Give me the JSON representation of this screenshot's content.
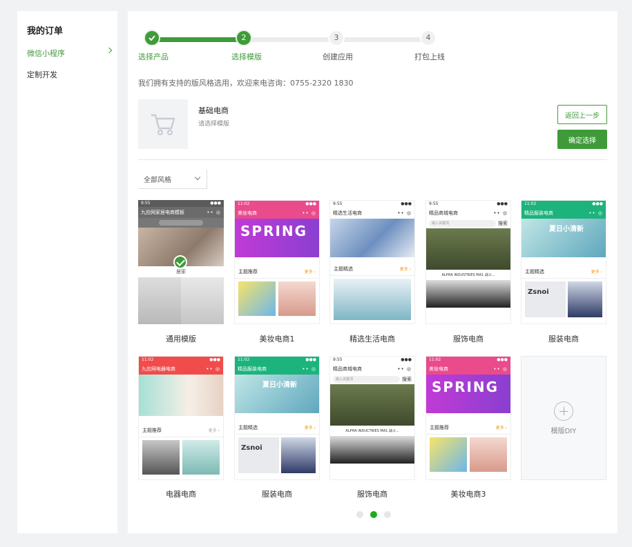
{
  "sidebar": {
    "title": "我的订单",
    "items": [
      {
        "label": "微信小程序",
        "active": true
      },
      {
        "label": "定制开发",
        "active": false
      }
    ]
  },
  "stepper": {
    "steps": [
      {
        "num": "",
        "label": "选择产品",
        "state": "done"
      },
      {
        "num": "2",
        "label": "选择模版",
        "state": "current"
      },
      {
        "num": "3",
        "label": "创建应用",
        "state": "todo"
      },
      {
        "num": "4",
        "label": "打包上线",
        "state": "todo"
      }
    ]
  },
  "notice": "我们拥有支持的版风格选用，欢迎来电咨询：0755-2320 1830",
  "product": {
    "name": "基础电商",
    "subtitle": "请选择模版",
    "back_label": "返回上一步",
    "confirm_label": "确定选择"
  },
  "filter": {
    "selected": "全部风格"
  },
  "templates": [
    {
      "label": "通用模版",
      "selected": true,
      "head": "九应网家居电商模板",
      "tab": "居家",
      "color": "#6b6b6b"
    },
    {
      "label": "美妆电商1",
      "selected": false,
      "head": "美妆电商",
      "banner": "SPRING",
      "section": "主题推荐",
      "color": "#e94b8b"
    },
    {
      "label": "精选生活电商",
      "selected": false,
      "head": "精选生活电商",
      "section": "主题精选",
      "color": "#ffffff"
    },
    {
      "label": "服饰电商",
      "selected": false,
      "head": "精品商城电商",
      "search_placeholder": "输入关键词",
      "search": "搜索",
      "product": "ALPHA INDUSTRIES MA1 战斗...",
      "color": "#ffffff"
    },
    {
      "label": "服装电商",
      "selected": false,
      "head": "精品服装电商",
      "banner": "夏日小清新",
      "section": "主题精选",
      "brand": "Zsnoi",
      "color": "#1db37c"
    },
    {
      "label": "电器电商",
      "selected": false,
      "head": "九应网电器电商",
      "section": "主题推荐",
      "color": "#f04c4c"
    },
    {
      "label": "服装电商",
      "selected": false,
      "head": "精品服装电商",
      "banner": "夏日小清新",
      "section": "主题精选",
      "brand": "Zsnoi",
      "color": "#1db37c"
    },
    {
      "label": "服饰电商",
      "selected": false,
      "head": "精品商城电商",
      "search_placeholder": "输入关键词",
      "search": "搜索",
      "product": "ALPHA INDUCTRIES MA1 战斗...",
      "color": "#ffffff"
    },
    {
      "label": "美妆电商3",
      "selected": false,
      "head": "美妆电商",
      "banner": "SPRING",
      "section": "主题推荐",
      "color": "#e94b8b"
    }
  ],
  "diy": {
    "label": "模版DIY"
  },
  "pager": {
    "pages": 3,
    "active": 2
  }
}
